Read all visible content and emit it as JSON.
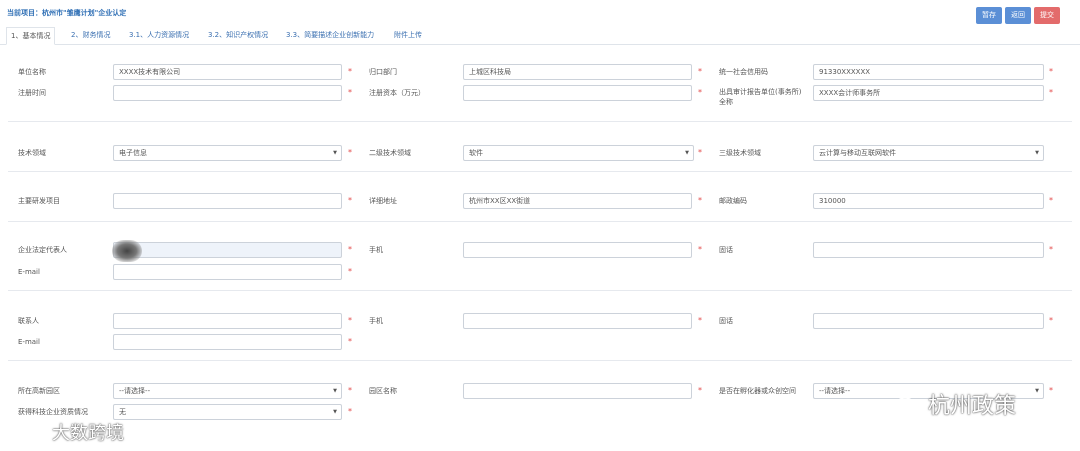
{
  "header": {
    "project_title": "当前项目：杭州市\"雏鹰计划\"企业认定",
    "buttons": {
      "save": "暂存",
      "return": "返回",
      "submit": "提交"
    }
  },
  "tabs": [
    "1、基本情况",
    "2、财务情况",
    "3.1、人力资源情况",
    "3.2、知识产权情况",
    "3.3、简要描述企业创新能力",
    "附件上传"
  ],
  "required_mark": "*",
  "form": {
    "unit_name": {
      "label": "单位名称",
      "value": "XXXX技术有限公司"
    },
    "department": {
      "label": "归口部门",
      "value": "上城区科技局"
    },
    "credit_code": {
      "label": "统一社会信用码",
      "value": "91330XXXXXX"
    },
    "reg_time": {
      "label": "注册时间",
      "value": ""
    },
    "reg_capital": {
      "label": "注册资本（万元）",
      "value": ""
    },
    "audit_unit": {
      "label1": "出具审计报告单位(事务所)",
      "label2": "全称",
      "value": "XXXX会计师事务所"
    },
    "tech_field": {
      "label": "技术领域",
      "value": "电子信息"
    },
    "tech_field2": {
      "label": "二级技术领域",
      "value": "软件"
    },
    "tech_field3": {
      "label": "三级技术领域",
      "value": "云计算与移动互联网软件"
    },
    "main_project": {
      "label": "主要研发项目",
      "value": ""
    },
    "address": {
      "label": "详细地址",
      "value": "杭州市XX区XX街道"
    },
    "postcode": {
      "label": "邮政编码",
      "value": "310000"
    },
    "legal_rep": {
      "label": "企业法定代表人",
      "value": ""
    },
    "legal_phone": {
      "label": "手机",
      "value": ""
    },
    "legal_tel": {
      "label": "固话",
      "value": ""
    },
    "legal_email": {
      "label": "E-mail",
      "value": ""
    },
    "contact": {
      "label": "联系人",
      "value": ""
    },
    "contact_phone": {
      "label": "手机",
      "value": ""
    },
    "contact_tel": {
      "label": "固话",
      "value": ""
    },
    "contact_email": {
      "label": "E-mail",
      "value": ""
    },
    "park": {
      "label": "所在高新园区",
      "value": "--请选择--"
    },
    "park_name": {
      "label": "园区名称",
      "value": ""
    },
    "incubator": {
      "label": "是否在孵化器或众创空间",
      "value": "--请选择--"
    },
    "qualification": {
      "label": "获得科技企业资质情况",
      "value": "无"
    }
  },
  "watermarks": {
    "wechat": "杭州政策",
    "brand": "大数跨境"
  }
}
